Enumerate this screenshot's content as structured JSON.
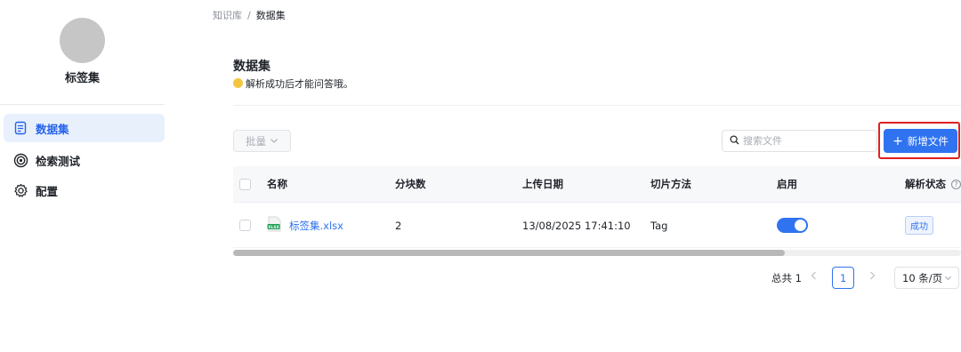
{
  "sidebar": {
    "kb_name": "标签集",
    "items": [
      {
        "label": "数据集",
        "icon": "document-icon",
        "active": true
      },
      {
        "label": "检索测试",
        "icon": "target-icon",
        "active": false
      },
      {
        "label": "配置",
        "icon": "gear-icon",
        "active": false
      }
    ]
  },
  "breadcrumb": {
    "root": "知识库",
    "separator": "/",
    "current": "数据集"
  },
  "header": {
    "title": "数据集",
    "tip": "解析成功后才能问答哦。"
  },
  "toolbar": {
    "batch_label": "批量",
    "search_placeholder": "搜索文件",
    "add_label": "新增文件"
  },
  "table": {
    "columns": [
      "名称",
      "分块数",
      "上传日期",
      "切片方法",
      "启用",
      "解析状态"
    ],
    "rows": [
      {
        "name": "标签集.xlsx",
        "file_type": "XLSX",
        "chunks": "2",
        "upload_date": "13/08/2025 17:41:10",
        "method": "Tag",
        "enabled": true,
        "status": "成功"
      }
    ]
  },
  "pagination": {
    "total_text": "总共 1",
    "current_page": "1",
    "page_size": "10 条/页"
  },
  "colors": {
    "accent": "#2f73f1",
    "highlight_frame": "#e02020",
    "active_nav_bg": "#e8f0fc"
  }
}
